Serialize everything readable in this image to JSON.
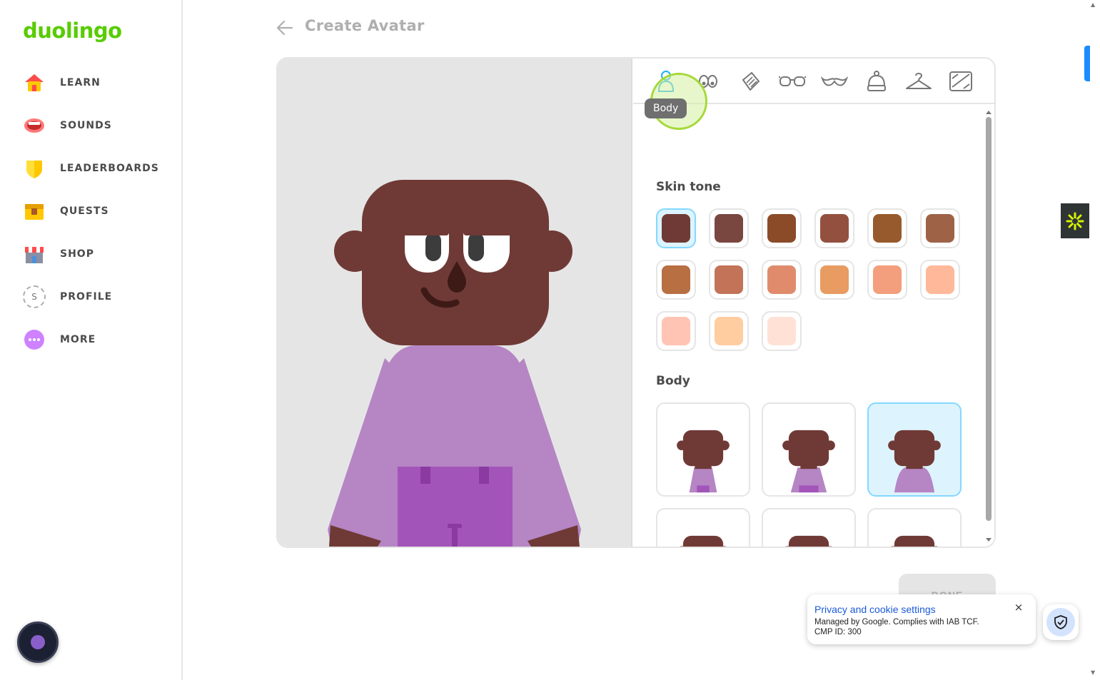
{
  "brand": {
    "logo_text": "duolingo"
  },
  "nav": {
    "items": [
      {
        "label": "LEARN",
        "icon": "home-icon"
      },
      {
        "label": "SOUNDS",
        "icon": "mouth-icon"
      },
      {
        "label": "LEADERBOARDS",
        "icon": "shield-trophy-icon"
      },
      {
        "label": "QUESTS",
        "icon": "treasure-chest-icon"
      },
      {
        "label": "SHOP",
        "icon": "shop-icon"
      },
      {
        "label": "PROFILE",
        "icon": "profile-avatar-icon",
        "avatar_letter": "S"
      },
      {
        "label": "MORE",
        "icon": "more-dots-icon"
      }
    ]
  },
  "header": {
    "title": "Create Avatar"
  },
  "categories": {
    "tooltip": "Body",
    "tabs": [
      "body-icon",
      "eyes-icon",
      "hair-comb-icon",
      "glasses-icon",
      "mustache-icon",
      "hat-icon",
      "hanger-icon",
      "background-frame-icon"
    ],
    "active": 0
  },
  "skin_tone": {
    "title": "Skin tone",
    "selected": 0,
    "colors": [
      "#6f3a36",
      "#7a4640",
      "#8b4b28",
      "#94503f",
      "#975a2c",
      "#9e6246",
      "#b86f42",
      "#c27358",
      "#e08c6c",
      "#e89c62",
      "#f39e7c",
      "#ffb89a",
      "#ffc4b4",
      "#ffcda0",
      "#ffe1d6"
    ]
  },
  "body": {
    "title": "Body",
    "selected": 2,
    "options": 6
  },
  "avatar": {
    "skin": "#6f3a36",
    "shirt": "#b585c4",
    "overalls": "#a354b9"
  },
  "footer": {
    "done_label": "DONE"
  },
  "cookie": {
    "title": "Privacy and cookie settings",
    "line1": "Managed by Google. Complies with IAB TCF.",
    "line2": "CMP ID: 300",
    "close": "×"
  }
}
